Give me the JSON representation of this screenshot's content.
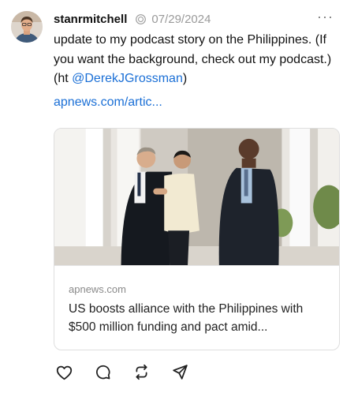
{
  "post": {
    "username": "stanrmitchell",
    "date": "07/29/2024",
    "more_label": "···",
    "text_main": "update to my podcast story on the Philippines. (If you want the background, check out my podcast.) (ht ",
    "mention": "@DerekJGrossman",
    "text_end": ")",
    "link_text": "apnews.com/artic..."
  },
  "link_card": {
    "domain": "apnews.com",
    "title": "US boosts alliance with the Philippines with $500 million funding and pact amid..."
  },
  "icons": {
    "avatar": "profile-photo",
    "verified": "verified-badge-icon",
    "more": "more-options-icon",
    "like": "heart-icon",
    "reply": "comment-icon",
    "repost": "repost-icon",
    "share": "send-icon"
  },
  "colors": {
    "link": "#1a6fd6",
    "muted": "#9a9a9a",
    "text": "#111111"
  }
}
